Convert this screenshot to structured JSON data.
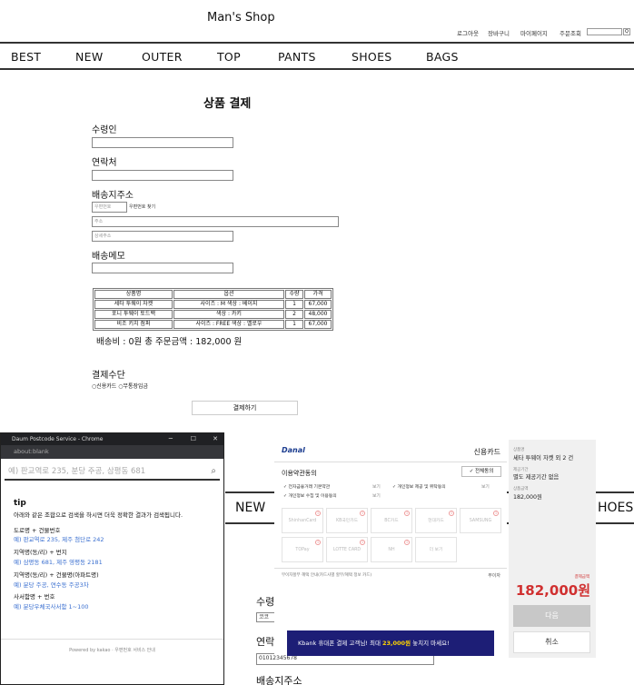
{
  "header": {
    "brand": "Man's Shop",
    "util_links": [
      "로그아웃",
      "장바구니",
      "마이페이지",
      "주문조회"
    ],
    "search_btn": "Q"
  },
  "nav": [
    "BEST",
    "NEW",
    "OUTER",
    "TOP",
    "PANTS",
    "SHOES",
    "BAGS"
  ],
  "checkout": {
    "title": "상품 결제",
    "recipient_label": "수령인",
    "phone_label": "연락처",
    "address_label": "배송지주소",
    "zip_placeholder": "우편번호",
    "zip_button": "우편번호 찾기",
    "addr_placeholder": "주소",
    "addr_detail_placeholder": "상세주소",
    "memo_label": "배송메모",
    "table_headers": [
      "상품명",
      "옵션",
      "수량",
      "가격"
    ],
    "rows": [
      [
        "세타 투웨이 자켓",
        "사이즈 : M 색상 : 베이지",
        "1",
        "67,000"
      ],
      [
        "포니 투웨이 토드백",
        "색상 : 카키",
        "2",
        "48,000"
      ],
      [
        "비조 키치 점퍼",
        "사이즈 : FREE 색상 : 옐로우",
        "1",
        "67,000"
      ]
    ],
    "summary": "배송비 : 0원  총 주문금액 : 182,000 원",
    "pay_method_label": "결제수단",
    "pay_options": "○신용카드 ○무통장입금",
    "pay_button": "결제하기"
  },
  "underlay": {
    "nav_left": "NEW",
    "nav_right": "HOES",
    "label1": "수령",
    "label2": "연락",
    "label3": "배송지주소",
    "input_phone": "01012345678",
    "input_small": "코코"
  },
  "daum": {
    "window_title": "Daum Postcode Service - Chrome",
    "url": "about:blank",
    "search_placeholder": "예) 판교역로 235, 분당 주공, 삼평동 681",
    "tip_title": "tip",
    "tip_desc": "아래와 같은 조합으로 검색을 하시면 더욱 정확한 결과가 검색됩니다.",
    "examples": [
      {
        "label": "도로명 + 건물번호",
        "ex": "예) 판교역로 235,  제주 첨단로 242"
      },
      {
        "label": "지역명(동/리) + 번지",
        "ex": "예) 삼평동 681,  제주 영평동 2181"
      },
      {
        "label": "지역명(동/리) + 건물명(아파트명)",
        "ex": "예) 분당 주공,  연수동 주공3차"
      },
      {
        "label": "사서함명 + 번호",
        "ex": "예) 분당우체국사서함 1~100"
      }
    ],
    "footer": "Powered by kakao   ·   우편번호 서비스 안내"
  },
  "danal": {
    "logo": "Danal",
    "title": "신용카드",
    "terms_title": "이용약관동의",
    "agree_all": "✓ 전체동의",
    "terms": [
      "전자금융거래 기본약관",
      "개인정보 수집 및 이용동의",
      "개인정보 제공 및 위탁동의"
    ],
    "view": "보기",
    "cards": [
      "ShinhanCard",
      "KB국민카드",
      "BC카드",
      "현대카드",
      "SAMSUNG",
      "TOPay",
      "LOTTE CARD",
      "NH",
      "더 보기"
    ],
    "note": "무이자할부 혜택 안내(카드사별 할부/혜택 정보 카드)",
    "no_interest": "무이자",
    "banner": "Kbank  휴대폰 결제 고객님! 최대 23,000원 놓치지 마세요!",
    "banner_highlight": "23,000원",
    "side": {
      "product_label": "상품명",
      "product_value": "세타 투웨이 자켓 외 2 건",
      "period_label": "제공기간",
      "period_value": "별도 제공기간 없음",
      "amount_label": "상품금액",
      "amount_value": "182,000원",
      "pay_label": "결제금액",
      "pay_amount": "182,000원",
      "next": "다음",
      "cancel": "취소"
    }
  }
}
